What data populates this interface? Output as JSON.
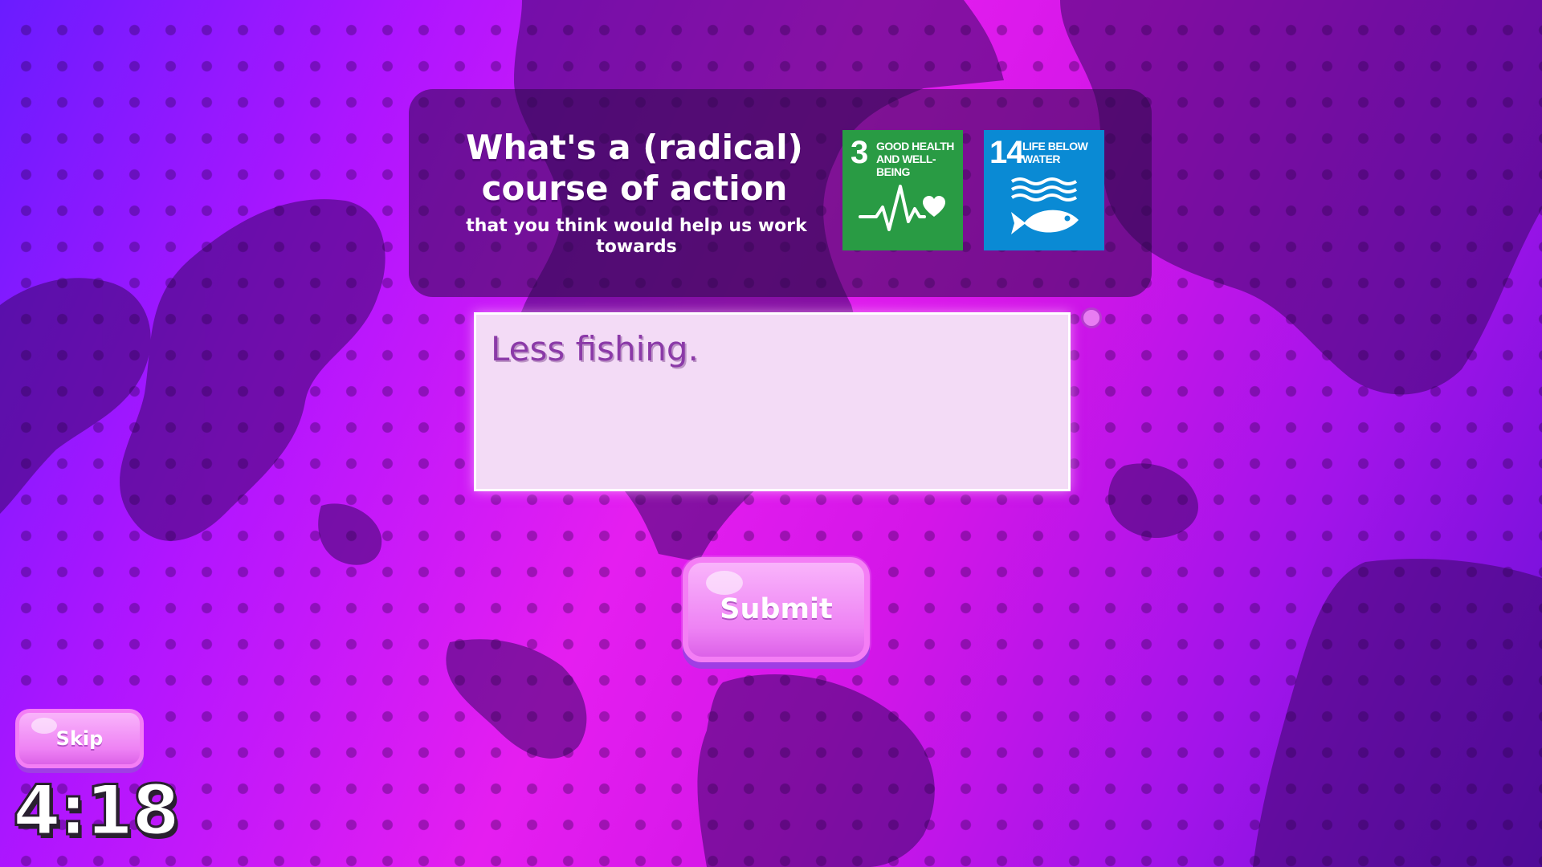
{
  "colors": {
    "panel_bg": "#2d0a4b",
    "sdg3_green": "#299b44",
    "sdg14_blue": "#0a8ad4",
    "button_pink": "#ee82f4",
    "answer_bg": "#f3dbf6",
    "answer_text": "#8b3aa8"
  },
  "prompt": {
    "heading": "What's a (radical) course of action",
    "subheading": "that you think would help us work towards"
  },
  "sdg_goals": [
    {
      "number": "3",
      "title": "Good Health and Well-Being",
      "icon": "heartbeat-icon",
      "color": "#299b44"
    },
    {
      "number": "14",
      "title": "Life Below Water",
      "icon": "fish-waves-icon",
      "color": "#0a8ad4"
    }
  ],
  "answer": {
    "value": "Less fishing."
  },
  "buttons": {
    "submit_label": "Submit",
    "skip_label": "Skip"
  },
  "timer": {
    "value": "4:18"
  }
}
